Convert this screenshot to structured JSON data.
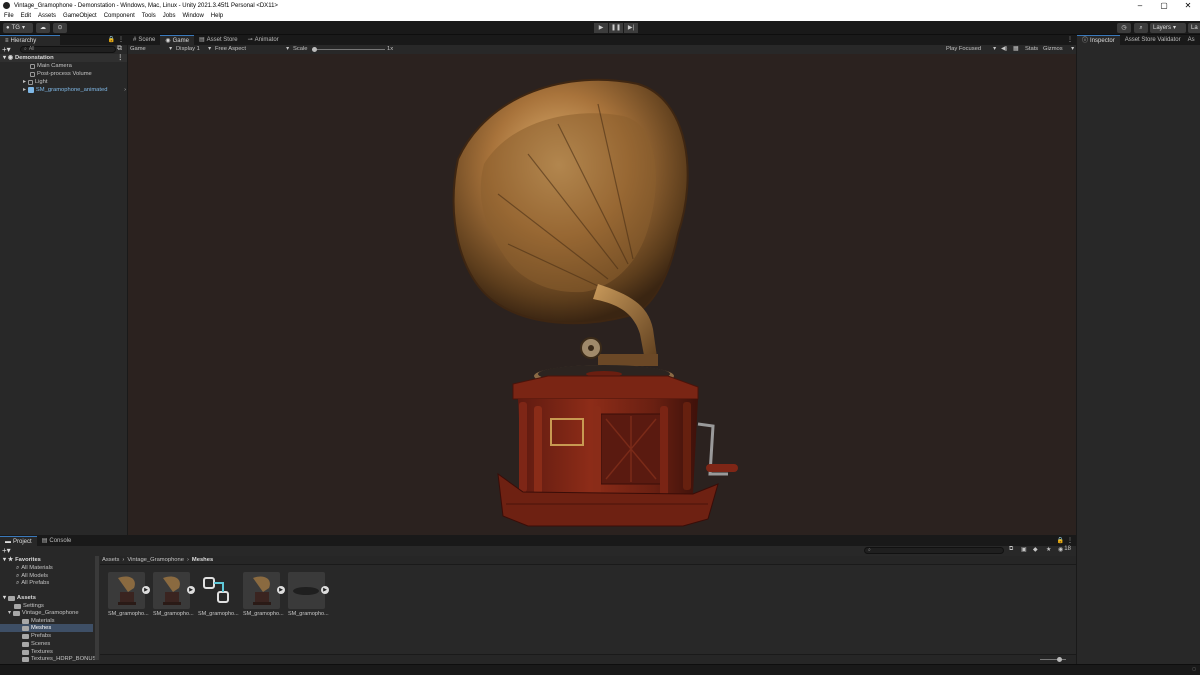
{
  "window": {
    "title": "Vintage_Gramophone - Demonstation - Windows, Mac, Linux - Unity 2021.3.45f1 Personal <DX11>",
    "controls": [
      "–",
      "▢",
      "✕"
    ]
  },
  "menu": [
    "File",
    "Edit",
    "Assets",
    "GameObject",
    "Component",
    "Tools",
    "Jobs",
    "Window",
    "Help"
  ],
  "toolbar": {
    "account": "TG",
    "layers": "Layers",
    "layout": "La"
  },
  "hierarchy": {
    "tab": "Hierarchy",
    "search_placeholder": "All",
    "scene": "Demonstation",
    "items": [
      "Main Camera",
      "Post-process Volume",
      "Light",
      "SM_gramophone_animated"
    ]
  },
  "center_tabs": [
    "Scene",
    "Game",
    "Asset Store",
    "Animator"
  ],
  "game_bar": {
    "mode": "Game",
    "display": "Display 1",
    "aspect": "Free Aspect",
    "scale_label": "Scale",
    "scale_value": "1x",
    "play_focus": "Play Focused",
    "stats": "Stats",
    "gizmos": "Gizmos"
  },
  "inspector_tabs": [
    "Inspector",
    "Asset Store Validator",
    "As"
  ],
  "project": {
    "tabs": [
      "Project",
      "Console"
    ],
    "favorites": "Favorites",
    "favorite_items": [
      "All Materials",
      "All Models",
      "All Prefabs"
    ],
    "assets": "Assets",
    "folders": [
      "Settings",
      "Vintage_Gramophone"
    ],
    "subfolders": [
      "Materials",
      "Meshes",
      "Prefabs",
      "Scenes",
      "Textures",
      "Textures_HDRP_BONUS"
    ],
    "breadcrumb": [
      "Assets",
      "Vintage_Gramophone",
      "Meshes"
    ],
    "assets_grid": [
      "SM_gramopho...",
      "SM_gramopho...",
      "SM_gramopho...",
      "SM_gramopho...",
      "SM_gramopho..."
    ],
    "hidden_count": "18"
  }
}
